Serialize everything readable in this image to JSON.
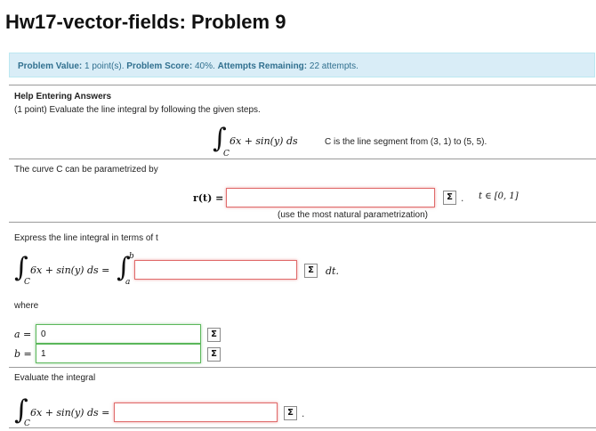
{
  "header": {
    "title": "Hw17-vector-fields: Problem 9"
  },
  "info": {
    "value_label": "Problem Value:",
    "value": "1 point(s).",
    "score_label": "Problem Score:",
    "score": "40%.",
    "attempts_label": "Attempts Remaining:",
    "attempts": "22 attempts."
  },
  "problem": {
    "help_link": "Help Entering Answers",
    "prompt": "(1 point) Evaluate the line integral by following the given steps.",
    "integrand": "6x + sin(y)  ds",
    "integral_sub": "C",
    "segment_note": "C is the line segment from (3, 1) to (5, 5).",
    "parametrized_text": "The curve C can be parametrized by",
    "r_label": "r(t) =",
    "r_value": "",
    "r_hint": "(use the most natural parametrization)",
    "t_range": "t ∈ [0, 1]",
    "express_text": "Express the line integral in terms of t",
    "express_lhs": "6x + sin(y)  ds =",
    "upper_limit": "b",
    "lower_limit": "a",
    "express_value": "",
    "dt_label": "dt.",
    "where_text": "where",
    "a_label": "a =",
    "a_value": "0",
    "b_label": "b =",
    "b_value": "1",
    "evaluate_text": "Evaluate the integral",
    "eval_lhs": "6x + sin(y)  ds =",
    "eval_value": ""
  },
  "icons": {
    "equation_editor": "sigma-icon"
  },
  "colors": {
    "info_bg": "#d9edf7",
    "info_text": "#31708f",
    "error_border": "#e06a6a",
    "correct_border": "#5cb85c"
  }
}
